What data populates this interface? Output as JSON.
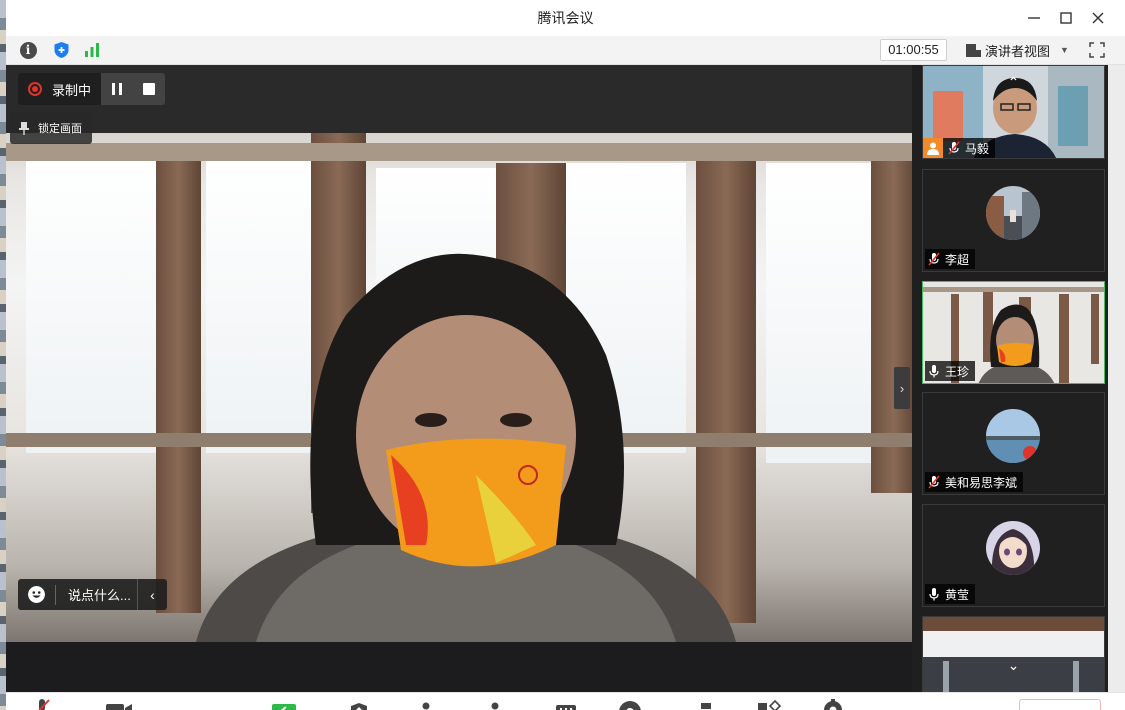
{
  "window": {
    "title": "腾讯会议"
  },
  "infobar": {
    "info_icon": "info-icon",
    "shield_icon": "shield-icon",
    "signal_icon": "signal-icon",
    "timer": "01:00:55",
    "view_mode": "演讲者视图",
    "fullscreen_icon": "fullscreen-icon"
  },
  "recording": {
    "status": "录制中",
    "pause_icon": "pause-icon",
    "stop_icon": "stop-icon",
    "lock_view": "锁定画面"
  },
  "chat": {
    "placeholder": "说点什么..."
  },
  "participants": [
    {
      "name": "马毅",
      "mic": "muted",
      "host": true,
      "video": true
    },
    {
      "name": "李超",
      "mic": "muted",
      "host": false,
      "video": false
    },
    {
      "name": "王珍",
      "mic": "on",
      "host": false,
      "video": true,
      "speaking": true
    },
    {
      "name": "美和易思李斌",
      "mic": "muted",
      "host": false,
      "video": false
    },
    {
      "name": "黄莹",
      "mic": "on",
      "host": false,
      "video": false
    }
  ],
  "colors": {
    "recording_red": "#e0332c",
    "active_border": "#3fbf5c",
    "host_badge": "#f38a2a",
    "shield_blue": "#1e7cf2",
    "signal_green": "#2fb84a"
  }
}
